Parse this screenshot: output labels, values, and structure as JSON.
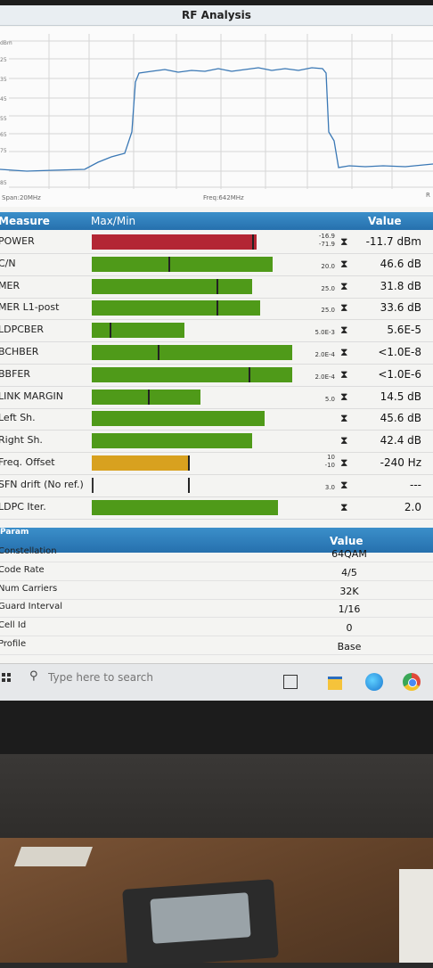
{
  "app": {
    "title": "RF Analysis"
  },
  "spectrum": {
    "y_unit": "dBm",
    "y_ticks": [
      "25",
      "35",
      "45",
      "55",
      "65",
      "75",
      "85"
    ],
    "span_label": "Span:20MHz",
    "freq_label": "Freq:642MHz",
    "right_label": "R"
  },
  "measure": {
    "headers": {
      "measure": "Measure",
      "maxmin": "Max/Min",
      "value": "Value"
    },
    "rows": [
      {
        "name": "POWER",
        "fill": 0.82,
        "color": "#b32634",
        "marker": 0.8,
        "lim_top": "-16.9",
        "lim_bot": "-71.9",
        "arrows": "⧗",
        "value": "-11.7 dBm"
      },
      {
        "name": "C/N",
        "fill": 0.9,
        "color": "#4f9a19",
        "marker": 0.38,
        "lim_top": "",
        "lim_bot": "20.0",
        "arrows": "⧗",
        "value": "46.6 dB"
      },
      {
        "name": "MER",
        "fill": 0.8,
        "color": "#4f9a19",
        "marker": 0.62,
        "lim_top": "",
        "lim_bot": "25.0",
        "arrows": "⧗",
        "value": "31.8 dB"
      },
      {
        "name": "MER L1-post",
        "fill": 0.84,
        "color": "#4f9a19",
        "marker": 0.62,
        "lim_top": "",
        "lim_bot": "25.0",
        "arrows": "⧗",
        "value": "33.6 dB"
      },
      {
        "name": "LDPCBER",
        "fill": 0.46,
        "color": "#4f9a19",
        "marker": 0.09,
        "lim_top": "",
        "lim_bot": "5.0E-3",
        "arrows": "⧗",
        "value": "5.6E-5"
      },
      {
        "name": "BCHBER",
        "fill": 1.0,
        "color": "#4f9a19",
        "marker": 0.33,
        "lim_top": "",
        "lim_bot": "2.0E-4",
        "arrows": "⧗",
        "value": "<1.0E-8"
      },
      {
        "name": "BBFER",
        "fill": 1.0,
        "color": "#4f9a19",
        "marker": 0.78,
        "lim_top": "",
        "lim_bot": "2.0E-4",
        "arrows": "⧗",
        "value": "<1.0E-6"
      },
      {
        "name": "LINK MARGIN",
        "fill": 0.54,
        "color": "#4f9a19",
        "marker": 0.28,
        "lim_top": "",
        "lim_bot": "5.0",
        "arrows": "⧗",
        "value": "14.5 dB"
      },
      {
        "name": "Left Sh.",
        "fill": 0.86,
        "color": "#4f9a19",
        "marker": -1,
        "lim_top": "",
        "lim_bot": "",
        "arrows": "⧗",
        "value": "45.6 dB"
      },
      {
        "name": "Right Sh.",
        "fill": 0.8,
        "color": "#4f9a19",
        "marker": -1,
        "lim_top": "",
        "lim_bot": "",
        "arrows": "⧗",
        "value": "42.4 dB"
      },
      {
        "name": "Freq. Offset",
        "fill": 0.48,
        "color": "#d8a11f",
        "marker": 0.48,
        "lim_top": "10",
        "lim_bot": "-10",
        "arrows": "⧗",
        "value": "-240 Hz"
      },
      {
        "name": "SFN drift (No ref.)",
        "fill": 0.0,
        "color": "#4f9a19",
        "marker": 0.48,
        "lim_top": "",
        "lim_bot": "3.0",
        "arrows": "⧗",
        "value": "---"
      },
      {
        "name": "LDPC Iter.",
        "fill": 0.93,
        "color": "#4f9a19",
        "marker": -1,
        "lim_top": "",
        "lim_bot": "",
        "arrows": "⧗",
        "value": "2.0"
      }
    ]
  },
  "params": {
    "header": "Param",
    "value_header": "Value",
    "rows": [
      {
        "name": "Constellation",
        "value": "64QAM"
      },
      {
        "name": "Code Rate",
        "value": "4/5"
      },
      {
        "name": "Num Carriers",
        "value": "32K"
      },
      {
        "name": "Guard Interval",
        "value": "1/16"
      },
      {
        "name": "Cell Id",
        "value": "0"
      },
      {
        "name": "Profile",
        "value": "Base"
      }
    ]
  },
  "taskbar": {
    "search_placeholder": "Type here to search"
  }
}
